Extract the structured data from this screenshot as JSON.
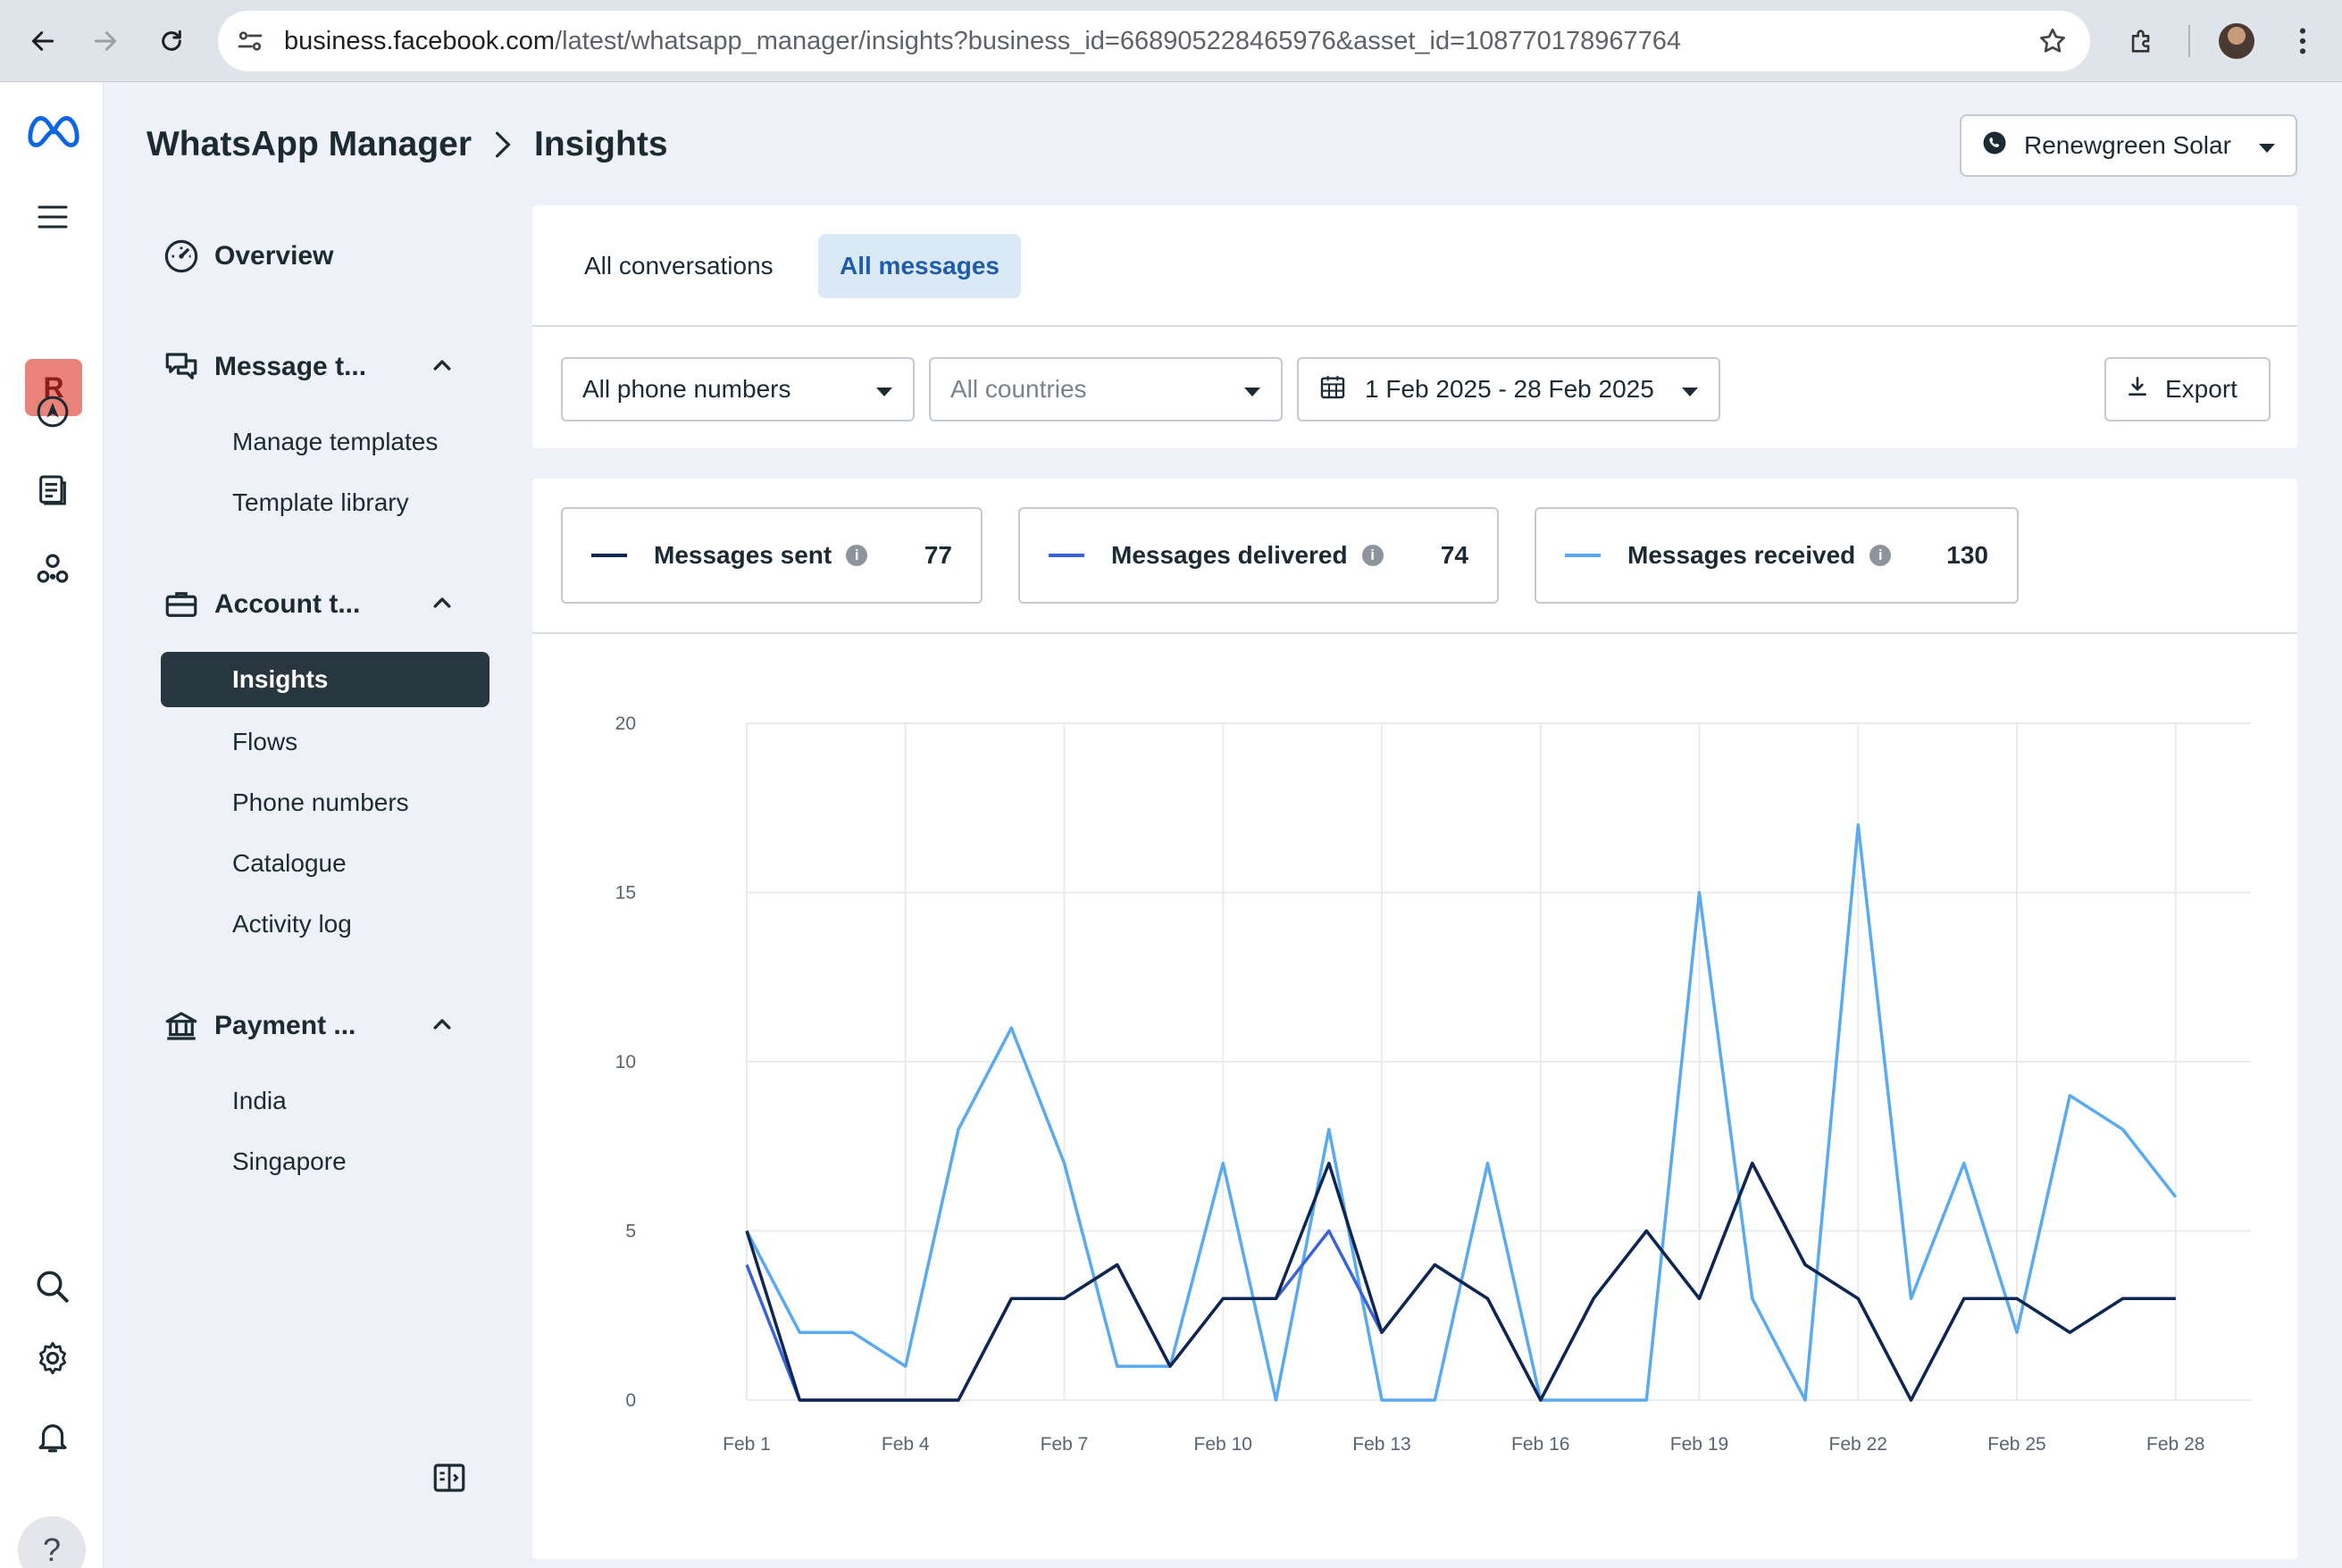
{
  "browser": {
    "url_host": "business.facebook.com",
    "url_path": "/latest/whatsapp_manager/insights?business_id=668905228465976&asset_id=108770178967764"
  },
  "rail": {
    "badge_letter": "R",
    "help_glyph": "?"
  },
  "header": {
    "app_title": "WhatsApp Manager",
    "page_title": "Insights",
    "business_name": "Renewgreen Solar"
  },
  "sidebar": {
    "overview": "Overview",
    "message_templates": "Message t...",
    "manage_templates": "Manage templates",
    "template_library": "Template library",
    "account_tools": "Account t...",
    "insights": "Insights",
    "flows": "Flows",
    "phone_numbers": "Phone numbers",
    "catalogue": "Catalogue",
    "activity_log": "Activity log",
    "payment": "Payment ...",
    "india": "India",
    "singapore": "Singapore"
  },
  "tabs": {
    "all_conversations": "All conversations",
    "all_messages": "All messages"
  },
  "filters": {
    "phone": "All phone numbers",
    "countries": "All countries",
    "date_range": "1 Feb 2025 - 28 Feb 2025",
    "export": "Export"
  },
  "metrics": {
    "sent_label": "Messages sent",
    "sent_value": "77",
    "delivered_label": "Messages delivered",
    "delivered_value": "74",
    "received_label": "Messages received",
    "received_value": "130"
  },
  "colors": {
    "sent": "#0f2650",
    "delivered": "#3b63d8",
    "received": "#5aaaf0",
    "sidebar_active": "#283640"
  },
  "chart_data": {
    "type": "line",
    "x": [
      "Feb 1",
      "Feb 2",
      "Feb 3",
      "Feb 4",
      "Feb 5",
      "Feb 6",
      "Feb 7",
      "Feb 8",
      "Feb 9",
      "Feb 10",
      "Feb 11",
      "Feb 12",
      "Feb 13",
      "Feb 14",
      "Feb 15",
      "Feb 16",
      "Feb 17",
      "Feb 18",
      "Feb 19",
      "Feb 20",
      "Feb 21",
      "Feb 22",
      "Feb 23",
      "Feb 24",
      "Feb 25",
      "Feb 26",
      "Feb 27",
      "Feb 28"
    ],
    "x_tick_labels": [
      "Feb 1",
      "Feb 4",
      "Feb 7",
      "Feb 10",
      "Feb 13",
      "Feb 16",
      "Feb 19",
      "Feb 22",
      "Feb 25",
      "Feb 28"
    ],
    "y_ticks": [
      0,
      5,
      10,
      15,
      20
    ],
    "ylim": [
      0,
      20
    ],
    "grid": true,
    "series": [
      {
        "name": "Messages received",
        "values": [
          5,
          2,
          2,
          1,
          8,
          11,
          7,
          1,
          1,
          7,
          0,
          8,
          0,
          0,
          7,
          0,
          0,
          0,
          15,
          3,
          0,
          17,
          3,
          7,
          2,
          9,
          8,
          6
        ]
      },
      {
        "name": "Messages delivered",
        "values": [
          4,
          0,
          0,
          0,
          0,
          3,
          3,
          4,
          1,
          3,
          3,
          5,
          2,
          4,
          3,
          0,
          3,
          5,
          3,
          7,
          4,
          3,
          0,
          3,
          3,
          2,
          3,
          3
        ]
      },
      {
        "name": "Messages sent",
        "values": [
          5,
          0,
          0,
          0,
          0,
          3,
          3,
          4,
          1,
          3,
          3,
          7,
          2,
          4,
          3,
          0,
          3,
          5,
          3,
          7,
          4,
          3,
          0,
          3,
          3,
          2,
          3,
          3
        ]
      }
    ]
  }
}
